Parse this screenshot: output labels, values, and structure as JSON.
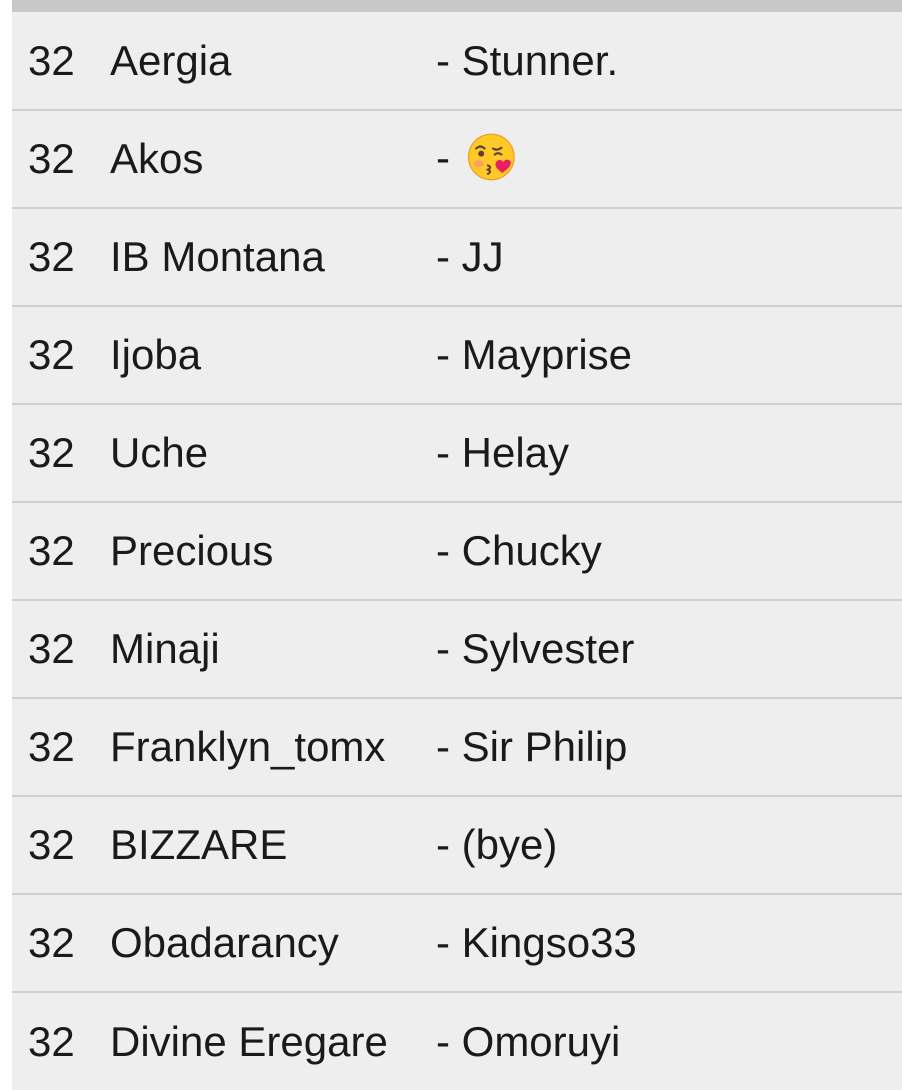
{
  "rows": [
    {
      "number": "32",
      "name": "Aergia",
      "partner": "- Stunner."
    },
    {
      "number": "32",
      "name": "Akos",
      "partner": "-",
      "partner_icon": "kissing-face-with-heart-emoji"
    },
    {
      "number": "32",
      "name": "IB Montana",
      "partner": "- JJ"
    },
    {
      "number": "32",
      "name": "Ijoba",
      "partner": "- Mayprise"
    },
    {
      "number": "32",
      "name": "Uche",
      "partner": "- Helay"
    },
    {
      "number": "32",
      "name": "Precious",
      "partner": "- Chucky"
    },
    {
      "number": "32",
      "name": "Minaji",
      "partner": "- Sylvester"
    },
    {
      "number": "32",
      "name": "Franklyn_tomx",
      "partner": "- Sir Philip"
    },
    {
      "number": "32",
      "name": "BIZZARE",
      "partner": "- (bye)"
    },
    {
      "number": "32",
      "name": "Obadarancy",
      "partner": "- Kingso33"
    },
    {
      "number": "32",
      "name": "Divine Eregare",
      "partner": "- Omoruyi"
    }
  ],
  "colors": {
    "row_background": "#eeeeee",
    "divider": "#d0d0d0",
    "top_bar": "#c8c8c8",
    "text": "#1a1a1a"
  }
}
